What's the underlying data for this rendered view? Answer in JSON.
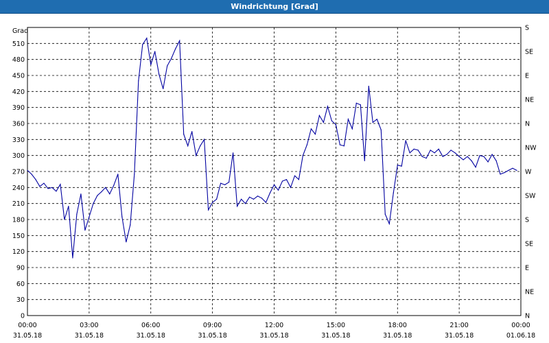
{
  "window": {
    "title": "Windrichtung [Grad]"
  },
  "chart_data": {
    "type": "line",
    "ylabel": "Grad",
    "ylim": [
      0,
      540
    ],
    "y_ticks": [
      0,
      30,
      60,
      90,
      120,
      150,
      180,
      210,
      240,
      270,
      300,
      330,
      360,
      390,
      420,
      450,
      480,
      510
    ],
    "right_axis_labels": [
      {
        "value": 0,
        "label": "N"
      },
      {
        "value": 45,
        "label": "NE"
      },
      {
        "value": 90,
        "label": "E"
      },
      {
        "value": 135,
        "label": "SE"
      },
      {
        "value": 180,
        "label": "S"
      },
      {
        "value": 225,
        "label": "SW"
      },
      {
        "value": 270,
        "label": "W"
      },
      {
        "value": 315,
        "label": "NW"
      },
      {
        "value": 360,
        "label": "N"
      },
      {
        "value": 405,
        "label": "NE"
      },
      {
        "value": 450,
        "label": "E"
      },
      {
        "value": 495,
        "label": "SE"
      },
      {
        "value": 540,
        "label": "S"
      }
    ],
    "x_ticks": [
      {
        "time": "00:00",
        "date": "31.05.18"
      },
      {
        "time": "03:00",
        "date": "31.05.18"
      },
      {
        "time": "06:00",
        "date": "31.05.18"
      },
      {
        "time": "09:00",
        "date": "31.05.18"
      },
      {
        "time": "12:00",
        "date": "31.05.18"
      },
      {
        "time": "15:00",
        "date": "31.05.18"
      },
      {
        "time": "18:00",
        "date": "31.05.18"
      },
      {
        "time": "21:00",
        "date": "31.05.18"
      },
      {
        "time": "00:00",
        "date": "01.06.18"
      }
    ],
    "grid": true,
    "line_color": "#0000a0",
    "series": [
      {
        "x_hours": [
          0,
          0.2,
          0.4,
          0.6,
          0.8,
          1.0,
          1.2,
          1.4,
          1.6,
          1.8,
          2.0,
          2.2,
          2.4,
          2.6,
          2.8,
          3.0,
          3.2,
          3.4,
          3.6,
          3.8,
          4.0,
          4.2,
          4.4,
          4.6,
          4.8,
          5.0,
          5.2,
          5.4,
          5.6,
          5.8,
          6.0,
          6.2,
          6.4,
          6.6,
          6.8,
          7.0,
          7.2,
          7.4,
          7.6,
          7.8,
          8.0,
          8.2,
          8.4,
          8.6,
          8.8,
          9.0,
          9.2,
          9.4,
          9.6,
          9.8,
          10.0,
          10.2,
          10.4,
          10.6,
          10.8,
          11.0,
          11.2,
          11.4,
          11.6,
          11.8,
          12.0,
          12.2,
          12.4,
          12.6,
          12.8,
          13.0,
          13.2,
          13.4,
          13.6,
          13.8,
          14.0,
          14.2,
          14.4,
          14.6,
          14.8,
          15.0,
          15.2,
          15.4,
          15.6,
          15.8,
          16.0,
          16.2,
          16.4,
          16.6,
          16.8,
          17.0,
          17.2,
          17.4,
          17.6,
          17.8,
          18.0,
          18.2,
          18.4,
          18.6,
          18.8,
          19.0,
          19.2,
          19.4,
          19.6,
          19.8,
          20.0,
          20.2,
          20.4,
          20.6,
          20.8,
          21.0,
          21.2,
          21.4,
          21.6,
          21.8,
          22.0,
          22.2,
          22.4,
          22.6,
          22.8,
          23.0,
          23.2,
          23.4,
          23.6,
          23.8
        ],
        "values": [
          272,
          265,
          255,
          242,
          248,
          238,
          240,
          233,
          246,
          180,
          205,
          108,
          190,
          228,
          160,
          185,
          210,
          225,
          232,
          240,
          228,
          244,
          265,
          185,
          138,
          170,
          265,
          440,
          508,
          520,
          470,
          495,
          452,
          425,
          468,
          482,
          500,
          515,
          340,
          318,
          345,
          300,
          318,
          330,
          198,
          212,
          218,
          248,
          245,
          250,
          305,
          205,
          218,
          210,
          222,
          218,
          224,
          220,
          212,
          230,
          245,
          235,
          252,
          255,
          240,
          262,
          255,
          300,
          320,
          350,
          340,
          375,
          362,
          392,
          365,
          358,
          320,
          318,
          368,
          350,
          398,
          395,
          290,
          430,
          362,
          368,
          348,
          190,
          172,
          230,
          282,
          280,
          328,
          305,
          312,
          310,
          298,
          295,
          310,
          305,
          312,
          298,
          302,
          310,
          305,
          298,
          292,
          298,
          290,
          278,
          300,
          298,
          288,
          302,
          290,
          265,
          268,
          272,
          276,
          272
        ]
      }
    ]
  }
}
